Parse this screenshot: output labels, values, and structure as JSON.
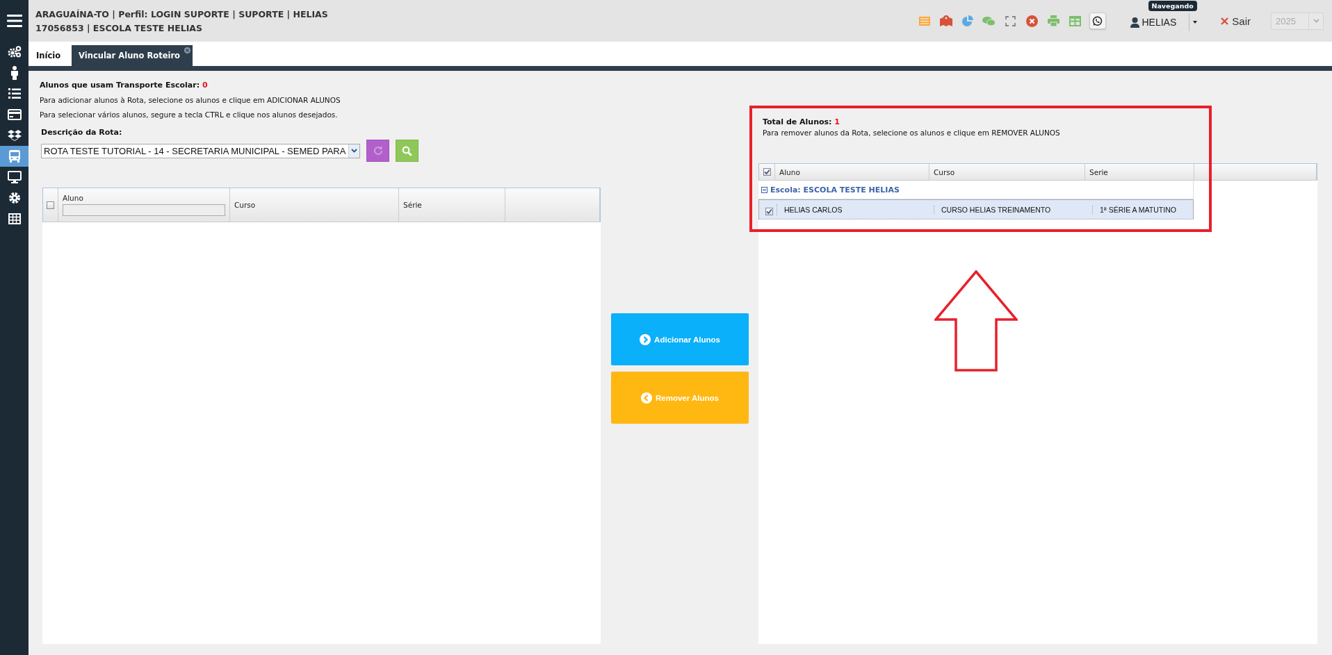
{
  "header": {
    "lines": [
      "ARAGUAÍNA-TO | Perfil: LOGIN SUPORTE | SUPORTE | HELIAS",
      "17056853 | ESCOLA TESTE HELIAS"
    ],
    "user": {
      "name": "HELIAS",
      "tooltip": "Navegando"
    },
    "logout": "Sair",
    "year": "2025"
  },
  "sidebar": {
    "items": [
      {
        "kind": "gears",
        "selected": false
      },
      {
        "kind": "person",
        "selected": false
      },
      {
        "kind": "list",
        "selected": false
      },
      {
        "kind": "card",
        "selected": false
      },
      {
        "kind": "boxes",
        "selected": false
      },
      {
        "kind": "bus",
        "selected": true
      },
      {
        "kind": "monitor",
        "selected": false
      },
      {
        "kind": "gear",
        "selected": false
      },
      {
        "kind": "table",
        "selected": false
      }
    ]
  },
  "tabs": [
    {
      "label": "Início",
      "selected": false,
      "closable": false
    },
    {
      "label": "Vincular Aluno Roteiro",
      "selected": true,
      "closable": true
    }
  ],
  "left": {
    "count_label": "Alunos que usam Transporte Escolar:",
    "count": "0",
    "hints": [
      "Para adicionar alunos à Rota, selecione os alunos e clique em ADICIONAR ALUNOS",
      "Para selecionar vários alunos, segure a tecla CTRL e clique nos alunos desejados."
    ],
    "route_label": "Descrição da Rota:",
    "route_value": "ROTA TESTE TUTORIAL - 14 - SECRETARIA MUNICIPAL - SEMED PARA",
    "table": {
      "select_all": false,
      "columns": [
        "Aluno",
        "Curso",
        "Série"
      ]
    }
  },
  "actions": [
    {
      "kind": "add",
      "label": "Adicionar Alunos"
    },
    {
      "kind": "remove",
      "label": "Remover Alunos"
    }
  ],
  "right": {
    "count_label": "Total de Alunos:",
    "count": "1",
    "hint": "Para remover alunos da Rota, selecione os alunos e clique em REMOVER ALUNOS",
    "table": {
      "select_all": true,
      "columns": [
        "Aluno",
        "Curso",
        "Serie"
      ],
      "groups": [
        {
          "label": "Escola: ESCOLA TESTE HELIAS",
          "expanded": true,
          "rows": [
            {
              "checked": true,
              "selected": true,
              "cells": [
                "HELIAS CARLOS",
                "CURSO HELIAS TREINAMENTO",
                "1ª SÉRIE A MATUTINO"
              ]
            }
          ]
        }
      ]
    }
  }
}
